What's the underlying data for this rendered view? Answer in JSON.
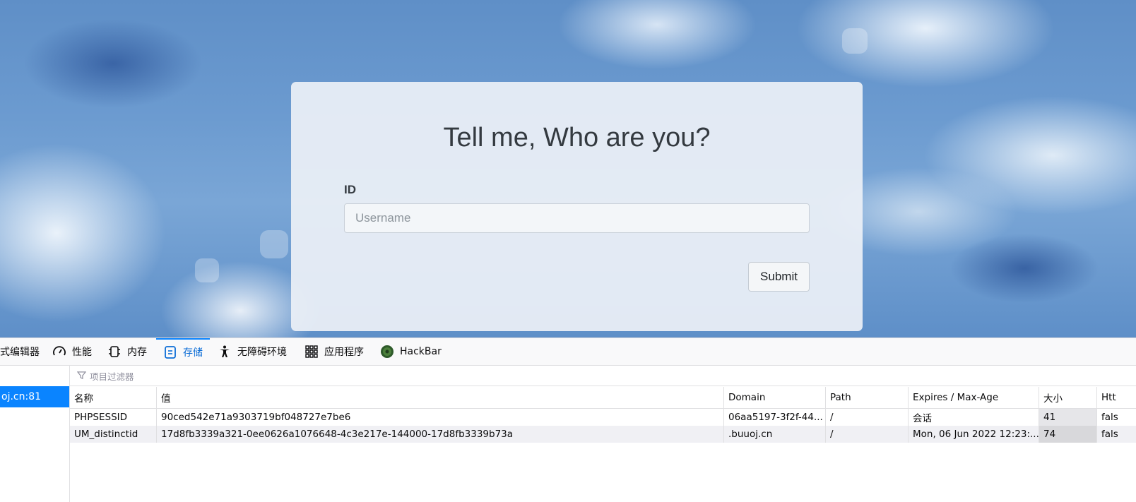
{
  "login": {
    "title": "Tell me, Who are you?",
    "id_label": "ID",
    "username_placeholder": "Username",
    "submit_label": "Submit"
  },
  "devtools": {
    "tabs": [
      {
        "label": "式编辑器",
        "icon": "style-editor-icon"
      },
      {
        "label": "性能",
        "icon": "performance-gauge-icon"
      },
      {
        "label": "内存",
        "icon": "memory-chip-icon"
      },
      {
        "label": "存储",
        "icon": "storage-icon",
        "active": true
      },
      {
        "label": "无障碍环境",
        "icon": "accessibility-icon"
      },
      {
        "label": "应用程序",
        "icon": "application-grid-icon"
      },
      {
        "label": "HackBar",
        "icon": "hackbar-logo-icon"
      }
    ],
    "sidebar": {
      "host": "oj.cn:81"
    },
    "filter_placeholder": "项目过滤器",
    "table": {
      "columns": [
        "名称",
        "值",
        "Domain",
        "Path",
        "Expires / Max-Age",
        "大小",
        "Htt"
      ],
      "rows": [
        [
          "PHPSESSID",
          "90ced542e71a9303719bf048727e7be6",
          "06aa5197-3f2f-44...",
          "/",
          "会话",
          "41",
          "fals"
        ],
        [
          "UM_distinctid",
          "17d8fb3339a321-0ee0626a1076648-4c3e217e-144000-17d8fb3339b73a",
          ".buuoj.cn",
          "/",
          "Mon, 06 Jun 2022 12:23:...",
          "74",
          "fals"
        ]
      ]
    },
    "accent_color": "#0a84ff"
  }
}
